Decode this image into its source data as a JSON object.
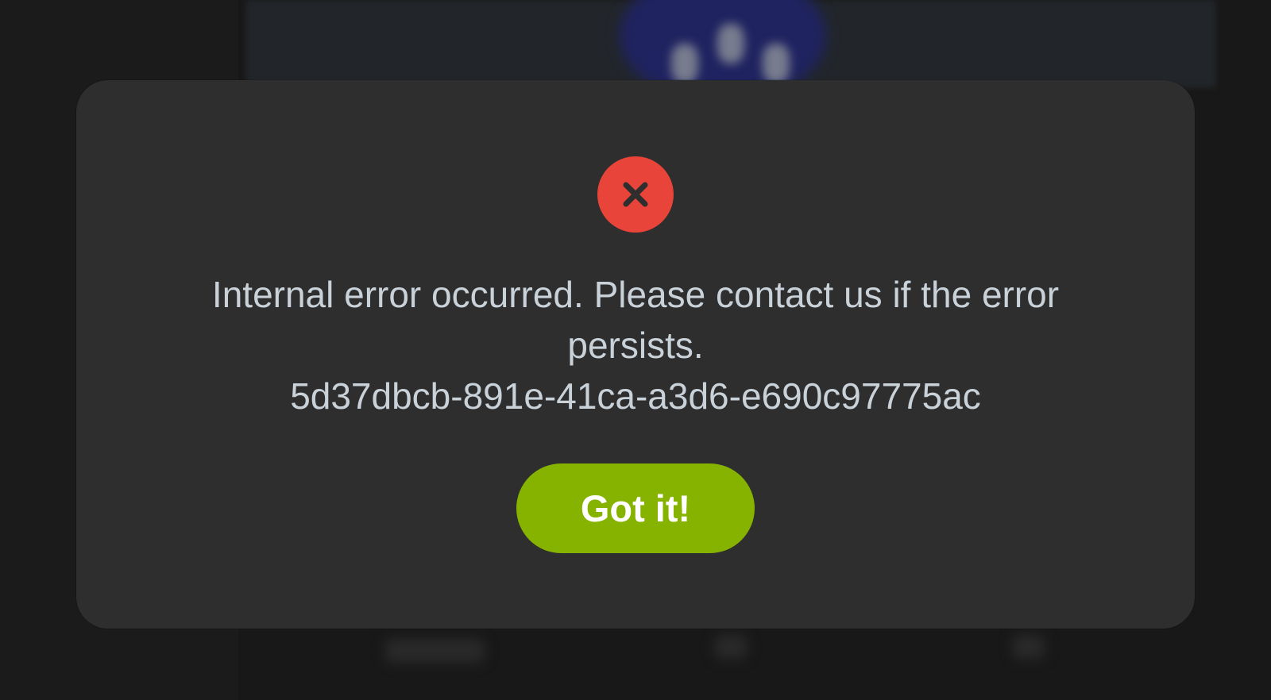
{
  "dialog": {
    "icon": "close-icon",
    "message_line1": "Internal error occurred. Please contact us if the error",
    "message_line2": "persists.",
    "error_id": "5d37dbcb-891e-41ca-a3d6-e690c97775ac",
    "button_label": "Got it!"
  },
  "colors": {
    "dialog_background": "#2e2e2e",
    "error_red": "#e8443a",
    "button_green": "#86b300",
    "message_text": "#c9d1d9"
  }
}
